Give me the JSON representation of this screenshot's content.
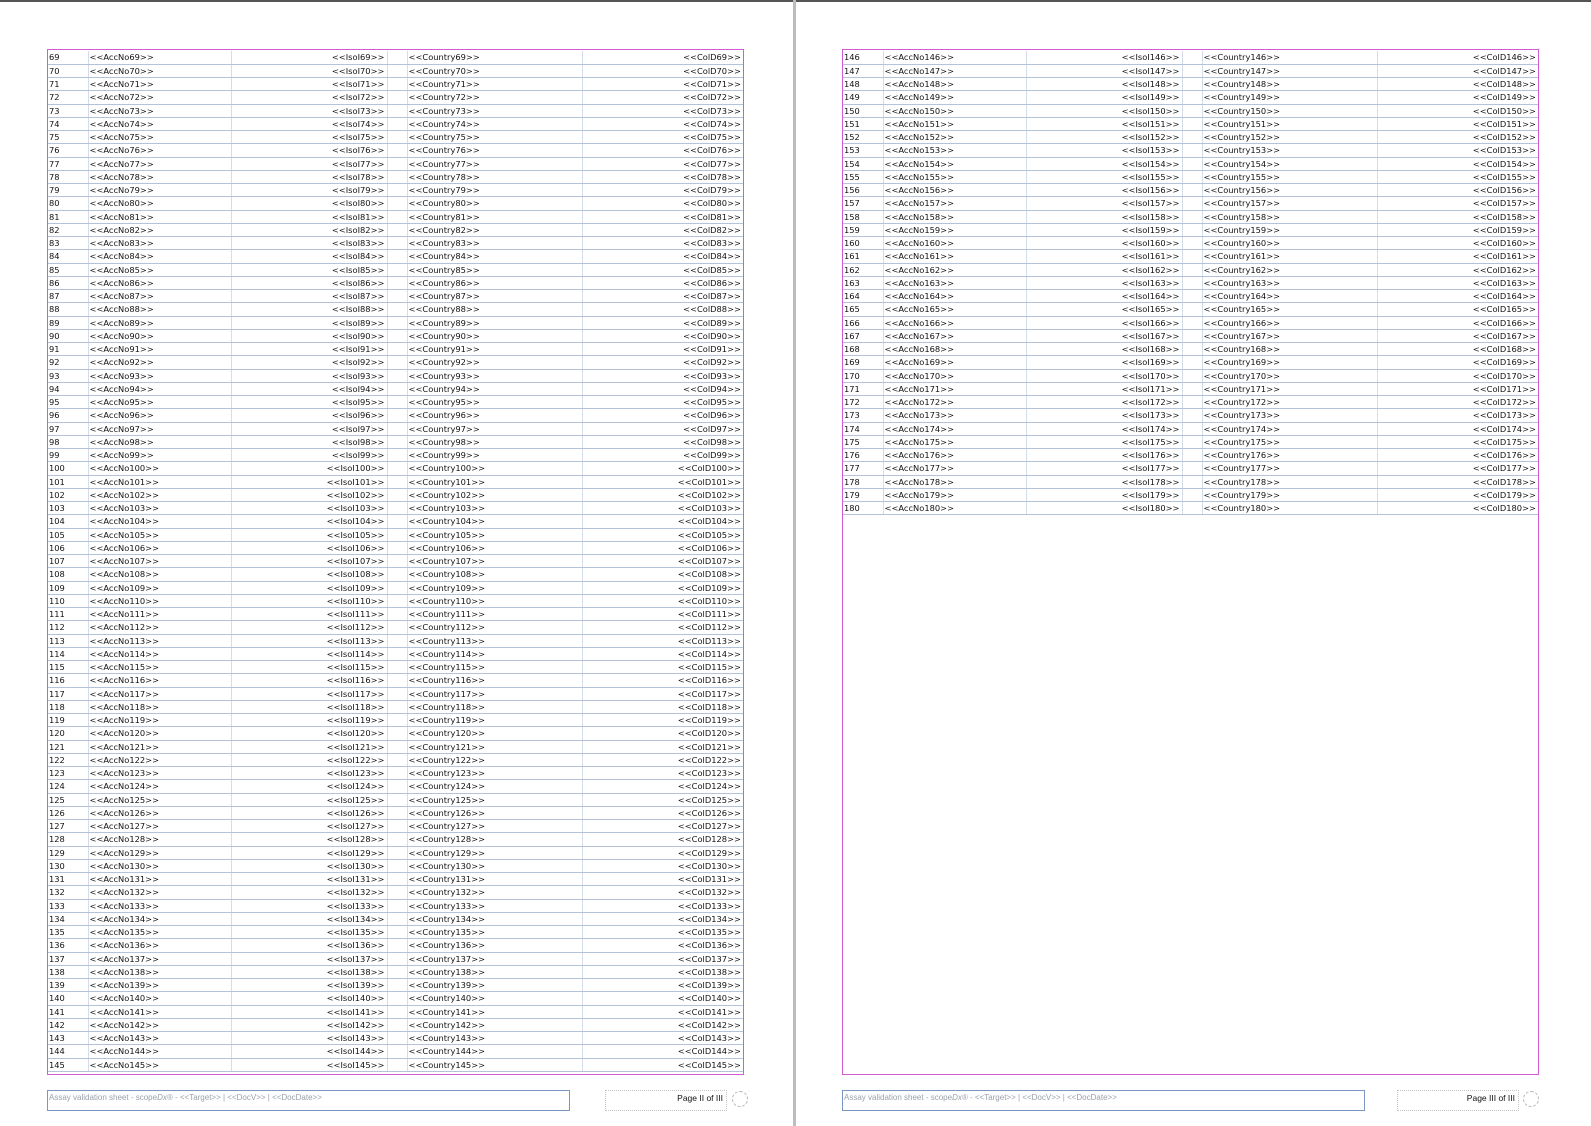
{
  "pages": [
    {
      "id": "left",
      "rows": [
        [
          "69",
          "<<AccNo69>>",
          "<<IsoI69>>",
          "<<Country69>>",
          "<<ColD69>>"
        ],
        [
          "70",
          "<<AccNo70>>",
          "<<IsoI70>>",
          "<<Country70>>",
          "<<ColD70>>"
        ],
        [
          "71",
          "<<AccNo71>>",
          "<<IsoI71>>",
          "<<Country71>>",
          "<<ColD71>>"
        ],
        [
          "72",
          "<<AccNo72>>",
          "<<IsoI72>>",
          "<<Country72>>",
          "<<ColD72>>"
        ],
        [
          "73",
          "<<AccNo73>>",
          "<<IsoI73>>",
          "<<Country73>>",
          "<<ColD73>>"
        ],
        [
          "74",
          "<<AccNo74>>",
          "<<IsoI74>>",
          "<<Country74>>",
          "<<ColD74>>"
        ],
        [
          "75",
          "<<AccNo75>>",
          "<<IsoI75>>",
          "<<Country75>>",
          "<<ColD75>>"
        ],
        [
          "76",
          "<<AccNo76>>",
          "<<IsoI76>>",
          "<<Country76>>",
          "<<ColD76>>"
        ],
        [
          "77",
          "<<AccNo77>>",
          "<<IsoI77>>",
          "<<Country77>>",
          "<<ColD77>>"
        ],
        [
          "78",
          "<<AccNo78>>",
          "<<IsoI78>>",
          "<<Country78>>",
          "<<ColD78>>"
        ],
        [
          "79",
          "<<AccNo79>>",
          "<<IsoI79>>",
          "<<Country79>>",
          "<<ColD79>>"
        ],
        [
          "80",
          "<<AccNo80>>",
          "<<IsoI80>>",
          "<<Country80>>",
          "<<ColD80>>"
        ],
        [
          "81",
          "<<AccNo81>>",
          "<<IsoI81>>",
          "<<Country81>>",
          "<<ColD81>>"
        ],
        [
          "82",
          "<<AccNo82>>",
          "<<IsoI82>>",
          "<<Country82>>",
          "<<ColD82>>"
        ],
        [
          "83",
          "<<AccNo83>>",
          "<<IsoI83>>",
          "<<Country83>>",
          "<<ColD83>>"
        ],
        [
          "84",
          "<<AccNo84>>",
          "<<IsoI84>>",
          "<<Country84>>",
          "<<ColD84>>"
        ],
        [
          "85",
          "<<AccNo85>>",
          "<<IsoI85>>",
          "<<Country85>>",
          "<<ColD85>>"
        ],
        [
          "86",
          "<<AccNo86>>",
          "<<IsoI86>>",
          "<<Country86>>",
          "<<ColD86>>"
        ],
        [
          "87",
          "<<AccNo87>>",
          "<<IsoI87>>",
          "<<Country87>>",
          "<<ColD87>>"
        ],
        [
          "88",
          "<<AccNo88>>",
          "<<IsoI88>>",
          "<<Country88>>",
          "<<ColD88>>"
        ],
        [
          "89",
          "<<AccNo89>>",
          "<<IsoI89>>",
          "<<Country89>>",
          "<<ColD89>>"
        ],
        [
          "90",
          "<<AccNo90>>",
          "<<IsoI90>>",
          "<<Country90>>",
          "<<ColD90>>"
        ],
        [
          "91",
          "<<AccNo91>>",
          "<<IsoI91>>",
          "<<Country91>>",
          "<<ColD91>>"
        ],
        [
          "92",
          "<<AccNo92>>",
          "<<IsoI92>>",
          "<<Country92>>",
          "<<ColD92>>"
        ],
        [
          "93",
          "<<AccNo93>>",
          "<<IsoI93>>",
          "<<Country93>>",
          "<<ColD93>>"
        ],
        [
          "94",
          "<<AccNo94>>",
          "<<IsoI94>>",
          "<<Country94>>",
          "<<ColD94>>"
        ],
        [
          "95",
          "<<AccNo95>>",
          "<<IsoI95>>",
          "<<Country95>>",
          "<<ColD95>>"
        ],
        [
          "96",
          "<<AccNo96>>",
          "<<IsoI96>>",
          "<<Country96>>",
          "<<ColD96>>"
        ],
        [
          "97",
          "<<AccNo97>>",
          "<<IsoI97>>",
          "<<Country97>>",
          "<<ColD97>>"
        ],
        [
          "98",
          "<<AccNo98>>",
          "<<IsoI98>>",
          "<<Country98>>",
          "<<ColD98>>"
        ],
        [
          "99",
          "<<AccNo99>>",
          "<<IsoI99>>",
          "<<Country99>>",
          "<<ColD99>>"
        ],
        [
          "100",
          "<<AccNo100>>",
          "<<IsoI100>>",
          "<<Country100>>",
          "<<ColD100>>"
        ],
        [
          "101",
          "<<AccNo101>>",
          "<<IsoI101>>",
          "<<Country101>>",
          "<<ColD101>>"
        ],
        [
          "102",
          "<<AccNo102>>",
          "<<IsoI102>>",
          "<<Country102>>",
          "<<ColD102>>"
        ],
        [
          "103",
          "<<AccNo103>>",
          "<<IsoI103>>",
          "<<Country103>>",
          "<<ColD103>>"
        ],
        [
          "104",
          "<<AccNo104>>",
          "<<IsoI104>>",
          "<<Country104>>",
          "<<ColD104>>"
        ],
        [
          "105",
          "<<AccNo105>>",
          "<<IsoI105>>",
          "<<Country105>>",
          "<<ColD105>>"
        ],
        [
          "106",
          "<<AccNo106>>",
          "<<IsoI106>>",
          "<<Country106>>",
          "<<ColD106>>"
        ],
        [
          "107",
          "<<AccNo107>>",
          "<<IsoI107>>",
          "<<Country107>>",
          "<<ColD107>>"
        ],
        [
          "108",
          "<<AccNo108>>",
          "<<IsoI108>>",
          "<<Country108>>",
          "<<ColD108>>"
        ],
        [
          "109",
          "<<AccNo109>>",
          "<<IsoI109>>",
          "<<Country109>>",
          "<<ColD109>>"
        ],
        [
          "110",
          "<<AccNo110>>",
          "<<IsoI110>>",
          "<<Country110>>",
          "<<ColD110>>"
        ],
        [
          "111",
          "<<AccNo111>>",
          "<<IsoI111>>",
          "<<Country111>>",
          "<<ColD111>>"
        ],
        [
          "112",
          "<<AccNo112>>",
          "<<IsoI112>>",
          "<<Country112>>",
          "<<ColD112>>"
        ],
        [
          "113",
          "<<AccNo113>>",
          "<<IsoI113>>",
          "<<Country113>>",
          "<<ColD113>>"
        ],
        [
          "114",
          "<<AccNo114>>",
          "<<IsoI114>>",
          "<<Country114>>",
          "<<ColD114>>"
        ],
        [
          "115",
          "<<AccNo115>>",
          "<<IsoI115>>",
          "<<Country115>>",
          "<<ColD115>>"
        ],
        [
          "116",
          "<<AccNo116>>",
          "<<IsoI116>>",
          "<<Country116>>",
          "<<ColD116>>"
        ],
        [
          "117",
          "<<AccNo117>>",
          "<<IsoI117>>",
          "<<Country117>>",
          "<<ColD117>>"
        ],
        [
          "118",
          "<<AccNo118>>",
          "<<IsoI118>>",
          "<<Country118>>",
          "<<ColD118>>"
        ],
        [
          "119",
          "<<AccNo119>>",
          "<<IsoI119>>",
          "<<Country119>>",
          "<<ColD119>>"
        ],
        [
          "120",
          "<<AccNo120>>",
          "<<IsoI120>>",
          "<<Country120>>",
          "<<ColD120>>"
        ],
        [
          "121",
          "<<AccNo121>>",
          "<<IsoI121>>",
          "<<Country121>>",
          "<<ColD121>>"
        ],
        [
          "122",
          "<<AccNo122>>",
          "<<IsoI122>>",
          "<<Country122>>",
          "<<ColD122>>"
        ],
        [
          "123",
          "<<AccNo123>>",
          "<<IsoI123>>",
          "<<Country123>>",
          "<<ColD123>>"
        ],
        [
          "124",
          "<<AccNo124>>",
          "<<IsoI124>>",
          "<<Country124>>",
          "<<ColD124>>"
        ],
        [
          "125",
          "<<AccNo125>>",
          "<<IsoI125>>",
          "<<Country125>>",
          "<<ColD125>>"
        ],
        [
          "126",
          "<<AccNo126>>",
          "<<IsoI126>>",
          "<<Country126>>",
          "<<ColD126>>"
        ],
        [
          "127",
          "<<AccNo127>>",
          "<<IsoI127>>",
          "<<Country127>>",
          "<<ColD127>>"
        ],
        [
          "128",
          "<<AccNo128>>",
          "<<IsoI128>>",
          "<<Country128>>",
          "<<ColD128>>"
        ],
        [
          "129",
          "<<AccNo129>>",
          "<<IsoI129>>",
          "<<Country129>>",
          "<<ColD129>>"
        ],
        [
          "130",
          "<<AccNo130>>",
          "<<IsoI130>>",
          "<<Country130>>",
          "<<ColD130>>"
        ],
        [
          "131",
          "<<AccNo131>>",
          "<<IsoI131>>",
          "<<Country131>>",
          "<<ColD131>>"
        ],
        [
          "132",
          "<<AccNo132>>",
          "<<IsoI132>>",
          "<<Country132>>",
          "<<ColD132>>"
        ],
        [
          "133",
          "<<AccNo133>>",
          "<<IsoI133>>",
          "<<Country133>>",
          "<<ColD133>>"
        ],
        [
          "134",
          "<<AccNo134>>",
          "<<IsoI134>>",
          "<<Country134>>",
          "<<ColD134>>"
        ],
        [
          "135",
          "<<AccNo135>>",
          "<<IsoI135>>",
          "<<Country135>>",
          "<<ColD135>>"
        ],
        [
          "136",
          "<<AccNo136>>",
          "<<IsoI136>>",
          "<<Country136>>",
          "<<ColD136>>"
        ],
        [
          "137",
          "<<AccNo137>>",
          "<<IsoI137>>",
          "<<Country137>>",
          "<<ColD137>>"
        ],
        [
          "138",
          "<<AccNo138>>",
          "<<IsoI138>>",
          "<<Country138>>",
          "<<ColD138>>"
        ],
        [
          "139",
          "<<AccNo139>>",
          "<<IsoI139>>",
          "<<Country139>>",
          "<<ColD139>>"
        ],
        [
          "140",
          "<<AccNo140>>",
          "<<IsoI140>>",
          "<<Country140>>",
          "<<ColD140>>"
        ],
        [
          "141",
          "<<AccNo141>>",
          "<<IsoI141>>",
          "<<Country141>>",
          "<<ColD141>>"
        ],
        [
          "142",
          "<<AccNo142>>",
          "<<IsoI142>>",
          "<<Country142>>",
          "<<ColD142>>"
        ],
        [
          "143",
          "<<AccNo143>>",
          "<<IsoI143>>",
          "<<Country143>>",
          "<<ColD143>>"
        ],
        [
          "144",
          "<<AccNo144>>",
          "<<IsoI144>>",
          "<<Country144>>",
          "<<ColD144>>"
        ],
        [
          "145",
          "<<AccNo145>>",
          "<<IsoI145>>",
          "<<Country145>>",
          "<<ColD145>>"
        ]
      ],
      "footer": {
        "text_prefix": "Assay validation sheet - scope",
        "text_brand": "Dx®",
        "text_suffix": " - <<Target>> | <<DocV>> | <<DocDate>>",
        "page_label": "Page II of III"
      }
    },
    {
      "id": "right",
      "rows": [
        [
          "146",
          "<<AccNo146>>",
          "<<IsoI146>>",
          "<<Country146>>",
          "<<ColD146>>"
        ],
        [
          "147",
          "<<AccNo147>>",
          "<<IsoI147>>",
          "<<Country147>>",
          "<<ColD147>>"
        ],
        [
          "148",
          "<<AccNo148>>",
          "<<IsoI148>>",
          "<<Country148>>",
          "<<ColD148>>"
        ],
        [
          "149",
          "<<AccNo149>>",
          "<<IsoI149>>",
          "<<Country149>>",
          "<<ColD149>>"
        ],
        [
          "150",
          "<<AccNo150>>",
          "<<IsoI150>>",
          "<<Country150>>",
          "<<ColD150>>"
        ],
        [
          "151",
          "<<AccNo151>>",
          "<<IsoI151>>",
          "<<Country151>>",
          "<<ColD151>>"
        ],
        [
          "152",
          "<<AccNo152>>",
          "<<IsoI152>>",
          "<<Country152>>",
          "<<ColD152>>"
        ],
        [
          "153",
          "<<AccNo153>>",
          "<<IsoI153>>",
          "<<Country153>>",
          "<<ColD153>>"
        ],
        [
          "154",
          "<<AccNo154>>",
          "<<IsoI154>>",
          "<<Country154>>",
          "<<ColD154>>"
        ],
        [
          "155",
          "<<AccNo155>>",
          "<<IsoI155>>",
          "<<Country155>>",
          "<<ColD155>>"
        ],
        [
          "156",
          "<<AccNo156>>",
          "<<IsoI156>>",
          "<<Country156>>",
          "<<ColD156>>"
        ],
        [
          "157",
          "<<AccNo157>>",
          "<<IsoI157>>",
          "<<Country157>>",
          "<<ColD157>>"
        ],
        [
          "158",
          "<<AccNo158>>",
          "<<IsoI158>>",
          "<<Country158>>",
          "<<ColD158>>"
        ],
        [
          "159",
          "<<AccNo159>>",
          "<<IsoI159>>",
          "<<Country159>>",
          "<<ColD159>>"
        ],
        [
          "160",
          "<<AccNo160>>",
          "<<IsoI160>>",
          "<<Country160>>",
          "<<ColD160>>"
        ],
        [
          "161",
          "<<AccNo161>>",
          "<<IsoI161>>",
          "<<Country161>>",
          "<<ColD161>>"
        ],
        [
          "162",
          "<<AccNo162>>",
          "<<IsoI162>>",
          "<<Country162>>",
          "<<ColD162>>"
        ],
        [
          "163",
          "<<AccNo163>>",
          "<<IsoI163>>",
          "<<Country163>>",
          "<<ColD163>>"
        ],
        [
          "164",
          "<<AccNo164>>",
          "<<IsoI164>>",
          "<<Country164>>",
          "<<ColD164>>"
        ],
        [
          "165",
          "<<AccNo165>>",
          "<<IsoI165>>",
          "<<Country165>>",
          "<<ColD165>>"
        ],
        [
          "166",
          "<<AccNo166>>",
          "<<IsoI166>>",
          "<<Country166>>",
          "<<ColD166>>"
        ],
        [
          "167",
          "<<AccNo167>>",
          "<<IsoI167>>",
          "<<Country167>>",
          "<<ColD167>>"
        ],
        [
          "168",
          "<<AccNo168>>",
          "<<IsoI168>>",
          "<<Country168>>",
          "<<ColD168>>"
        ],
        [
          "169",
          "<<AccNo169>>",
          "<<IsoI169>>",
          "<<Country169>>",
          "<<ColD169>>"
        ],
        [
          "170",
          "<<AccNo170>>",
          "<<IsoI170>>",
          "<<Country170>>",
          "<<ColD170>>"
        ],
        [
          "171",
          "<<AccNo171>>",
          "<<IsoI171>>",
          "<<Country171>>",
          "<<ColD171>>"
        ],
        [
          "172",
          "<<AccNo172>>",
          "<<IsoI172>>",
          "<<Country172>>",
          "<<ColD172>>"
        ],
        [
          "173",
          "<<AccNo173>>",
          "<<IsoI173>>",
          "<<Country173>>",
          "<<ColD173>>"
        ],
        [
          "174",
          "<<AccNo174>>",
          "<<IsoI174>>",
          "<<Country174>>",
          "<<ColD174>>"
        ],
        [
          "175",
          "<<AccNo175>>",
          "<<IsoI175>>",
          "<<Country175>>",
          "<<ColD175>>"
        ],
        [
          "176",
          "<<AccNo176>>",
          "<<IsoI176>>",
          "<<Country176>>",
          "<<ColD176>>"
        ],
        [
          "177",
          "<<AccNo177>>",
          "<<IsoI177>>",
          "<<Country177>>",
          "<<ColD177>>"
        ],
        [
          "178",
          "<<AccNo178>>",
          "<<IsoI178>>",
          "<<Country178>>",
          "<<ColD178>>"
        ],
        [
          "179",
          "<<AccNo179>>",
          "<<IsoI179>>",
          "<<Country179>>",
          "<<ColD179>>"
        ],
        [
          "180",
          "<<AccNo180>>",
          "<<IsoI180>>",
          "<<Country180>>",
          "<<ColD180>>"
        ]
      ],
      "footer": {
        "text_prefix": "Assay validation sheet - scope",
        "text_brand": "Dx®",
        "text_suffix": " - <<Target>> | <<DocV>> | <<DocDate>>",
        "page_label": "Page III of III"
      }
    }
  ],
  "colors": {
    "frame": "#cf5bd8",
    "row_rule": "#b4c2dc",
    "footer_border": "#7c96c4"
  },
  "icons": {
    "footer_logo": "logo-placeholder-icon"
  }
}
